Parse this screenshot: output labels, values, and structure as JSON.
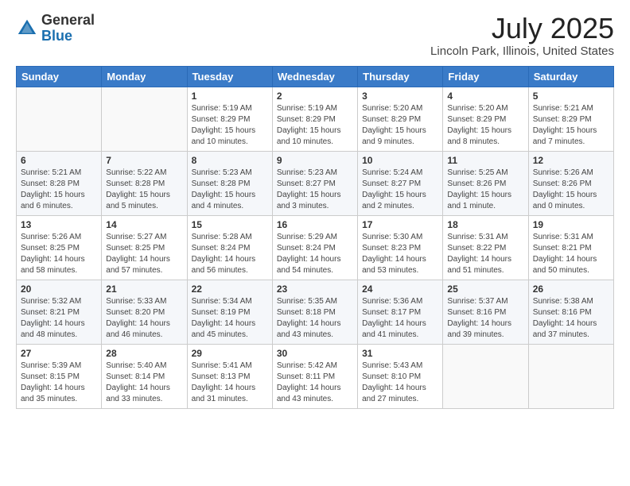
{
  "logo": {
    "general": "General",
    "blue": "Blue"
  },
  "header": {
    "month": "July 2025",
    "location": "Lincoln Park, Illinois, United States"
  },
  "weekdays": [
    "Sunday",
    "Monday",
    "Tuesday",
    "Wednesday",
    "Thursday",
    "Friday",
    "Saturday"
  ],
  "weeks": [
    [
      {
        "day": "",
        "info": ""
      },
      {
        "day": "",
        "info": ""
      },
      {
        "day": "1",
        "info": "Sunrise: 5:19 AM\nSunset: 8:29 PM\nDaylight: 15 hours and 10 minutes."
      },
      {
        "day": "2",
        "info": "Sunrise: 5:19 AM\nSunset: 8:29 PM\nDaylight: 15 hours and 10 minutes."
      },
      {
        "day": "3",
        "info": "Sunrise: 5:20 AM\nSunset: 8:29 PM\nDaylight: 15 hours and 9 minutes."
      },
      {
        "day": "4",
        "info": "Sunrise: 5:20 AM\nSunset: 8:29 PM\nDaylight: 15 hours and 8 minutes."
      },
      {
        "day": "5",
        "info": "Sunrise: 5:21 AM\nSunset: 8:29 PM\nDaylight: 15 hours and 7 minutes."
      }
    ],
    [
      {
        "day": "6",
        "info": "Sunrise: 5:21 AM\nSunset: 8:28 PM\nDaylight: 15 hours and 6 minutes."
      },
      {
        "day": "7",
        "info": "Sunrise: 5:22 AM\nSunset: 8:28 PM\nDaylight: 15 hours and 5 minutes."
      },
      {
        "day": "8",
        "info": "Sunrise: 5:23 AM\nSunset: 8:28 PM\nDaylight: 15 hours and 4 minutes."
      },
      {
        "day": "9",
        "info": "Sunrise: 5:23 AM\nSunset: 8:27 PM\nDaylight: 15 hours and 3 minutes."
      },
      {
        "day": "10",
        "info": "Sunrise: 5:24 AM\nSunset: 8:27 PM\nDaylight: 15 hours and 2 minutes."
      },
      {
        "day": "11",
        "info": "Sunrise: 5:25 AM\nSunset: 8:26 PM\nDaylight: 15 hours and 1 minute."
      },
      {
        "day": "12",
        "info": "Sunrise: 5:26 AM\nSunset: 8:26 PM\nDaylight: 15 hours and 0 minutes."
      }
    ],
    [
      {
        "day": "13",
        "info": "Sunrise: 5:26 AM\nSunset: 8:25 PM\nDaylight: 14 hours and 58 minutes."
      },
      {
        "day": "14",
        "info": "Sunrise: 5:27 AM\nSunset: 8:25 PM\nDaylight: 14 hours and 57 minutes."
      },
      {
        "day": "15",
        "info": "Sunrise: 5:28 AM\nSunset: 8:24 PM\nDaylight: 14 hours and 56 minutes."
      },
      {
        "day": "16",
        "info": "Sunrise: 5:29 AM\nSunset: 8:24 PM\nDaylight: 14 hours and 54 minutes."
      },
      {
        "day": "17",
        "info": "Sunrise: 5:30 AM\nSunset: 8:23 PM\nDaylight: 14 hours and 53 minutes."
      },
      {
        "day": "18",
        "info": "Sunrise: 5:31 AM\nSunset: 8:22 PM\nDaylight: 14 hours and 51 minutes."
      },
      {
        "day": "19",
        "info": "Sunrise: 5:31 AM\nSunset: 8:21 PM\nDaylight: 14 hours and 50 minutes."
      }
    ],
    [
      {
        "day": "20",
        "info": "Sunrise: 5:32 AM\nSunset: 8:21 PM\nDaylight: 14 hours and 48 minutes."
      },
      {
        "day": "21",
        "info": "Sunrise: 5:33 AM\nSunset: 8:20 PM\nDaylight: 14 hours and 46 minutes."
      },
      {
        "day": "22",
        "info": "Sunrise: 5:34 AM\nSunset: 8:19 PM\nDaylight: 14 hours and 45 minutes."
      },
      {
        "day": "23",
        "info": "Sunrise: 5:35 AM\nSunset: 8:18 PM\nDaylight: 14 hours and 43 minutes."
      },
      {
        "day": "24",
        "info": "Sunrise: 5:36 AM\nSunset: 8:17 PM\nDaylight: 14 hours and 41 minutes."
      },
      {
        "day": "25",
        "info": "Sunrise: 5:37 AM\nSunset: 8:16 PM\nDaylight: 14 hours and 39 minutes."
      },
      {
        "day": "26",
        "info": "Sunrise: 5:38 AM\nSunset: 8:16 PM\nDaylight: 14 hours and 37 minutes."
      }
    ],
    [
      {
        "day": "27",
        "info": "Sunrise: 5:39 AM\nSunset: 8:15 PM\nDaylight: 14 hours and 35 minutes."
      },
      {
        "day": "28",
        "info": "Sunrise: 5:40 AM\nSunset: 8:14 PM\nDaylight: 14 hours and 33 minutes."
      },
      {
        "day": "29",
        "info": "Sunrise: 5:41 AM\nSunset: 8:13 PM\nDaylight: 14 hours and 31 minutes."
      },
      {
        "day": "30",
        "info": "Sunrise: 5:42 AM\nSunset: 8:11 PM\nDaylight: 14 hours and 43 minutes."
      },
      {
        "day": "31",
        "info": "Sunrise: 5:43 AM\nSunset: 8:10 PM\nDaylight: 14 hours and 27 minutes."
      },
      {
        "day": "",
        "info": ""
      },
      {
        "day": "",
        "info": ""
      }
    ]
  ]
}
